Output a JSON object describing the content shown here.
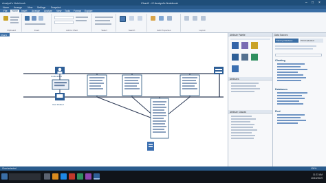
{
  "window": {
    "app_name": "Analyst's Notebook",
    "document_title": "Chart1 - i2 Analyst's Notebook",
    "minimize_icon": "minimize-icon",
    "maximize_icon": "maximize-icon",
    "close_icon": "close-icon"
  },
  "menu": [
    "Home",
    "Arrange",
    "View",
    "Settings",
    "Snapshot"
  ],
  "ribbon_tabs": [
    "File",
    "Home",
    "Insert",
    "Arrange",
    "Analyze",
    "View",
    "Tools",
    "Format",
    "Explore"
  ],
  "ribbon_groups": [
    "Clipboard",
    "Insert",
    "Add to Chart",
    "Select",
    "Search",
    "Edit Properties",
    "Layout"
  ],
  "chart_tab": "Chart1",
  "nodes": {
    "entity_left": "Unidentified",
    "entity_left_sub": "User Eluded",
    "entity_right": "ZEUS"
  },
  "mid_panel": {
    "header": "Attribute Palette",
    "section_top": "Attributes",
    "section_bottom": "Attribute Classes"
  },
  "right_panel": {
    "header": "Data Sources",
    "sections": [
      "Charting",
      "Databases",
      "Find"
    ],
    "tabs": [
      "Training Database",
      "PC19 selected"
    ]
  },
  "statusbar": {
    "left_text": "Chart selected",
    "right_text": "100%"
  },
  "taskbar": {
    "time": "11:23 AM",
    "date": "10/10/2019"
  },
  "colors": {
    "titlebar": "#1f4e79",
    "ribbon_tab_active": "#f4f6f9",
    "link_line": "#3a4a6a",
    "node_label_border": "#1f4e79",
    "taskbar": "#10141a"
  }
}
